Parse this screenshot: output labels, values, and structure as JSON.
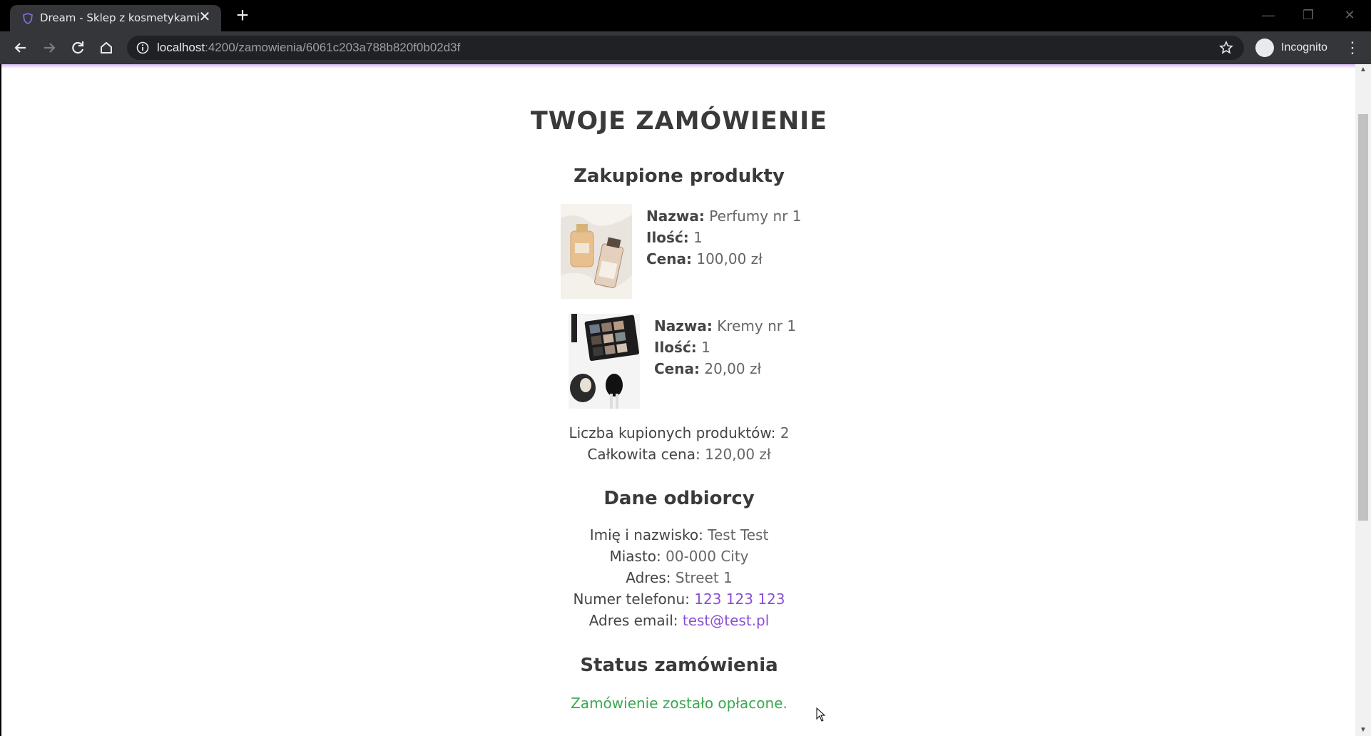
{
  "browser": {
    "tab_title": "Dream - Sklep z kosmetykami",
    "url_host": "localhost",
    "url_path": ":4200/zamowienia/6061c203a788b820f0b02d3f",
    "profile_label": "Incognito"
  },
  "page": {
    "title": "TWOJE ZAMÓWIENIE",
    "products_heading": "Zakupione produkty",
    "labels": {
      "name": "Nazwa:",
      "qty": "Ilość:",
      "price": "Cena:"
    },
    "products": [
      {
        "name": "Perfumy nr 1",
        "qty": "1",
        "price": "100,00 zł",
        "image": "perfume-bottles"
      },
      {
        "name": "Kremy nr 1",
        "qty": "1",
        "price": "20,00 zł",
        "image": "eyeshadow-palette-brushes"
      }
    ],
    "summary": {
      "count_label": "Liczba kupionych produktów:",
      "count_value": "2",
      "total_label": "Całkowita cena:",
      "total_value": "120,00 zł"
    },
    "recipient_heading": "Dane odbiorcy",
    "recipient": {
      "name_label": "Imię i nazwisko:",
      "name_value": "Test Test",
      "city_label": "Miasto:",
      "city_value": "00-000 City",
      "address_label": "Adres:",
      "address_value": "Street 1",
      "phone_label": "Numer telefonu:",
      "phone_value": "123 123 123",
      "email_label": "Adres email:",
      "email_value": "test@test.pl"
    },
    "status_heading": "Status zamówienia",
    "status_text": "Zamówienie zostało opłacone."
  },
  "colors": {
    "link": "#8a4fd6",
    "paid": "#3aa84e",
    "accent_line": "#d9b8f0"
  }
}
